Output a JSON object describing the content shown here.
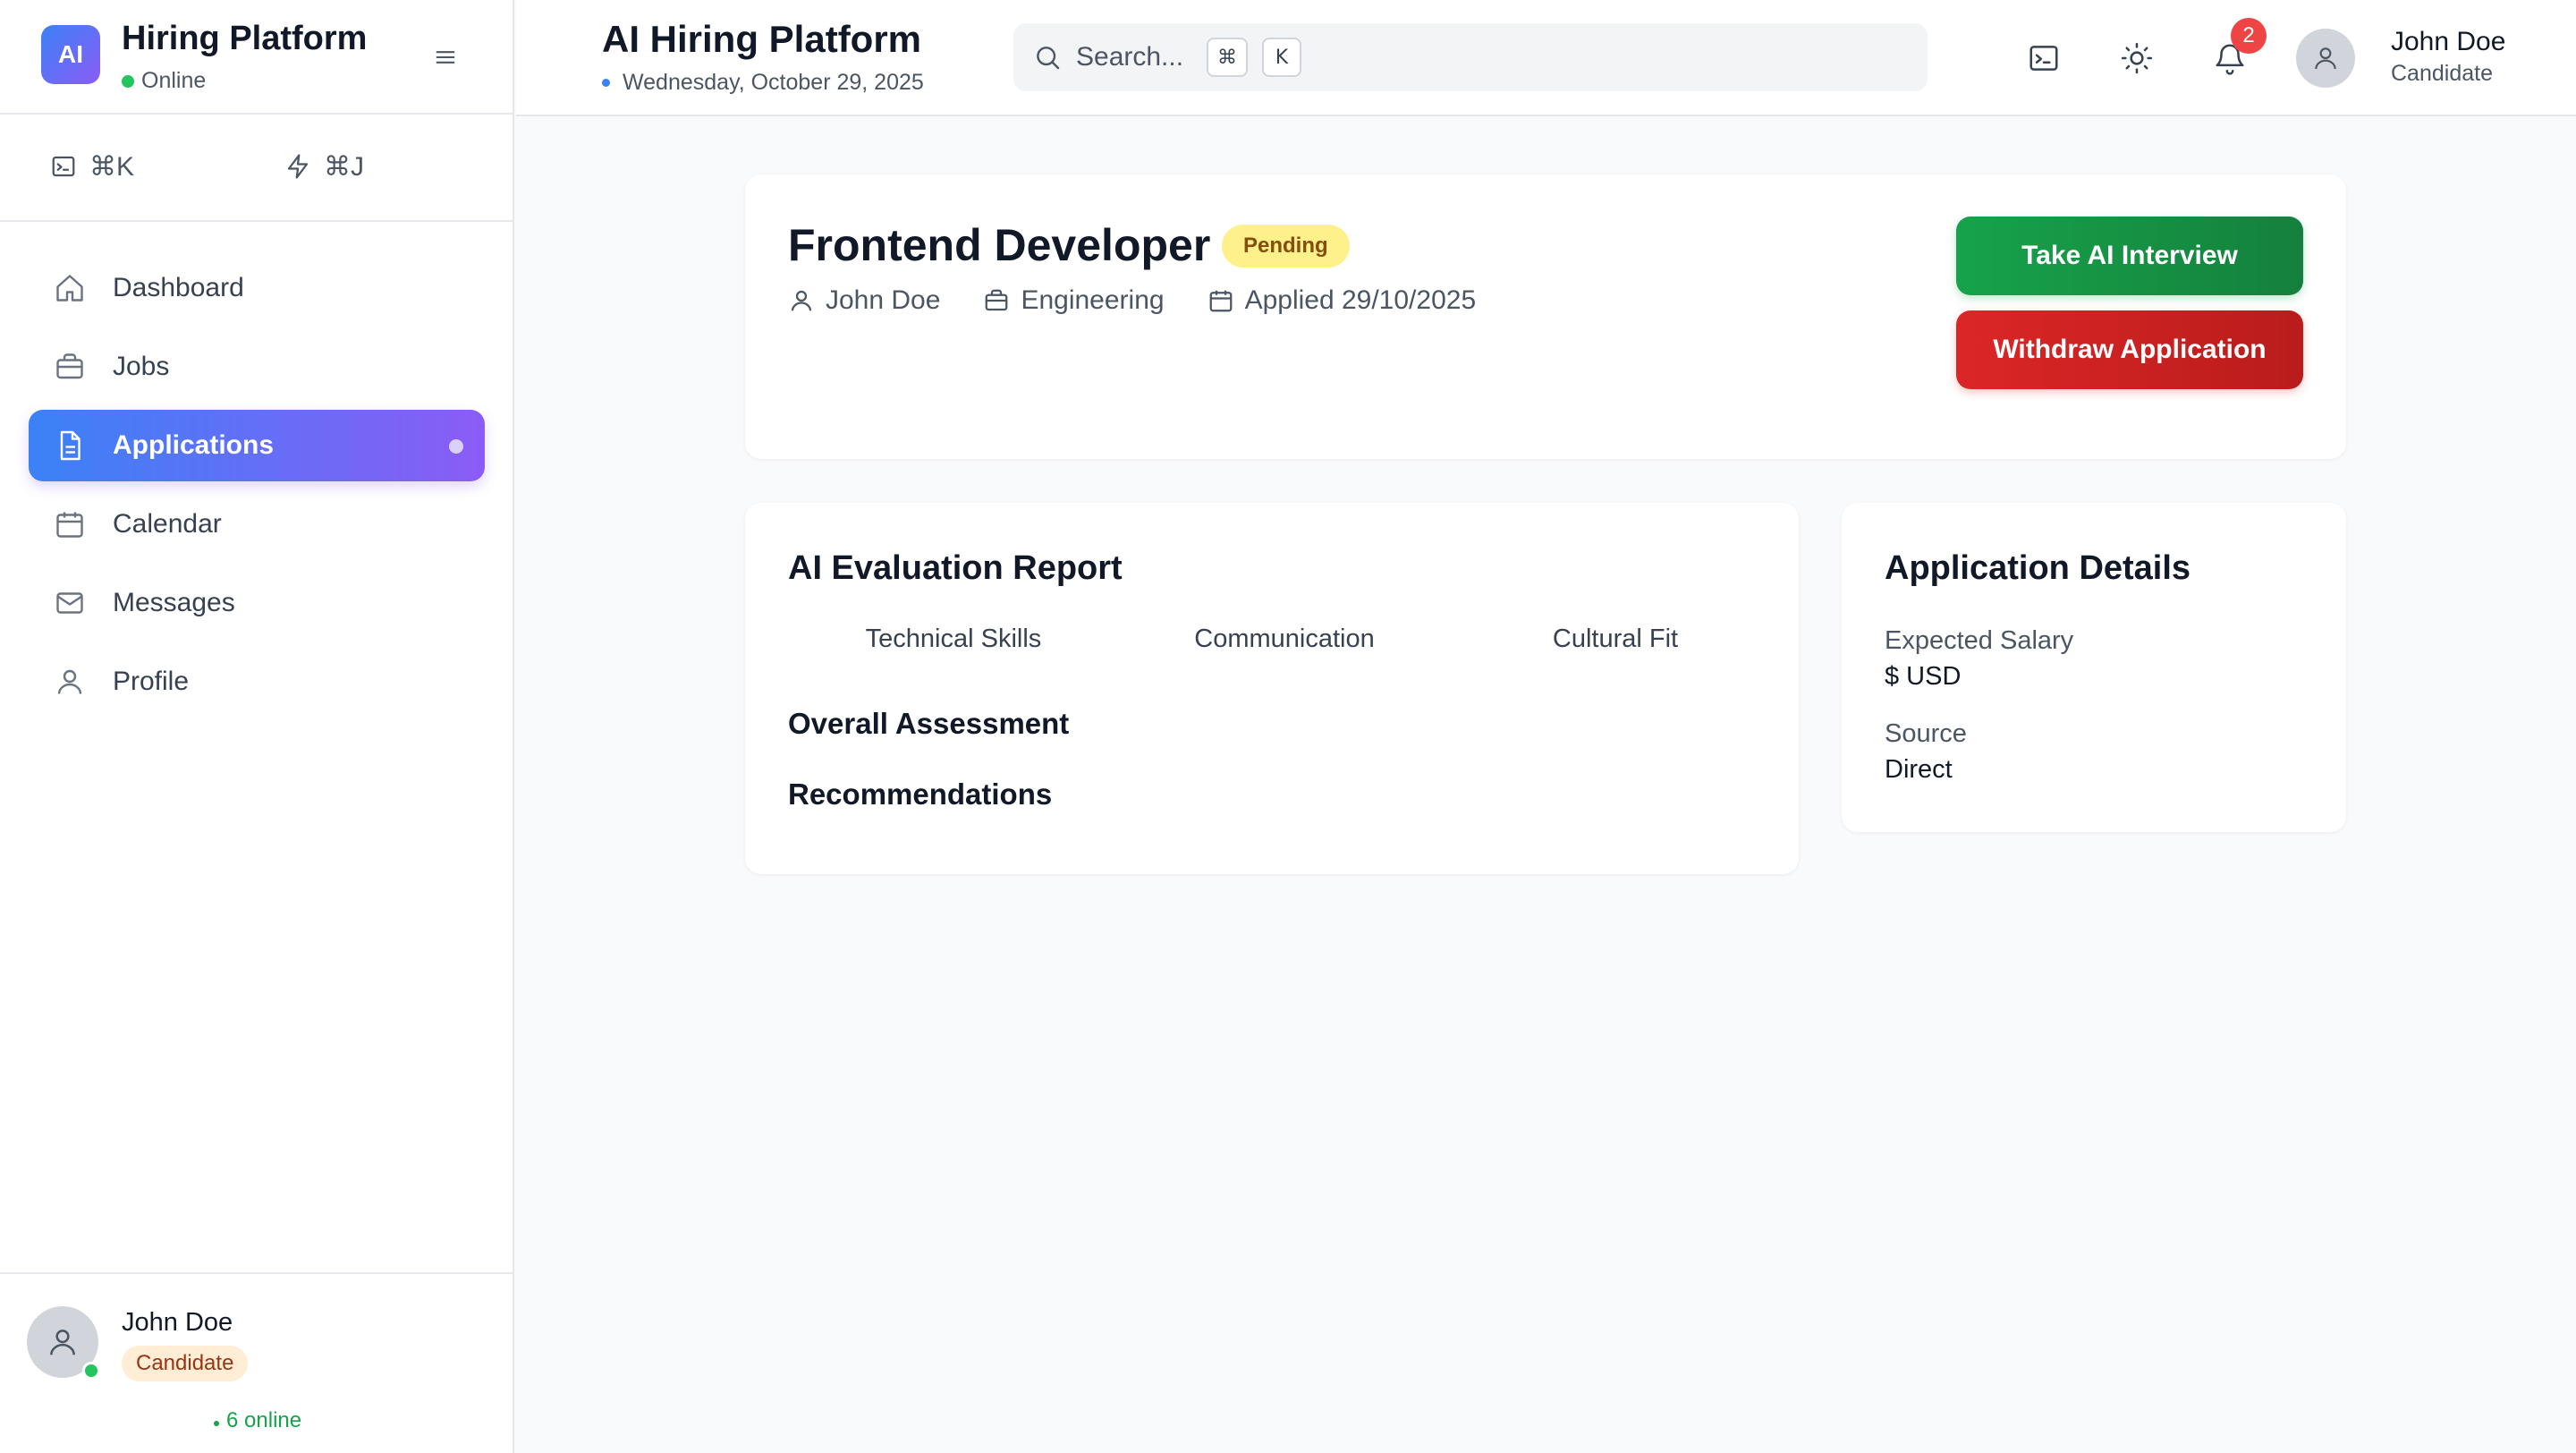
{
  "sidebar": {
    "logo_text": "AI",
    "title": "Hiring Platform",
    "status": "Online",
    "shortcuts": [
      {
        "icon": "terminal-icon",
        "label": "⌘K"
      },
      {
        "icon": "bolt-icon",
        "label": "⌘J"
      }
    ],
    "nav": [
      {
        "icon": "home-icon",
        "label": "Dashboard",
        "active": false
      },
      {
        "icon": "briefcase-icon",
        "label": "Jobs",
        "active": false
      },
      {
        "icon": "document-icon",
        "label": "Applications",
        "active": true
      },
      {
        "icon": "calendar-icon",
        "label": "Calendar",
        "active": false
      },
      {
        "icon": "mail-icon",
        "label": "Messages",
        "active": false
      },
      {
        "icon": "user-icon",
        "label": "Profile",
        "active": false
      }
    ],
    "user": {
      "name": "John Doe",
      "role": "Candidate"
    },
    "online_count": "6 online"
  },
  "topbar": {
    "title": "AI Hiring Platform",
    "date": "Wednesday, October 29, 2025",
    "search": {
      "placeholder": "Search...",
      "kbd1": "⌘",
      "kbd2": "K"
    },
    "notifications_count": "2",
    "user": {
      "name": "John Doe",
      "role": "Candidate"
    }
  },
  "application": {
    "job_title": "Frontend Developer",
    "status": "Pending",
    "candidate": "John Doe",
    "department": "Engineering",
    "applied": "Applied 29/10/2025",
    "actions": {
      "interview": "Take AI Interview",
      "withdraw": "Withdraw Application"
    }
  },
  "evaluation": {
    "title": "AI Evaluation Report",
    "categories": [
      "Technical Skills",
      "Communication",
      "Cultural Fit"
    ],
    "overall_title": "Overall Assessment",
    "recommendations_title": "Recommendations"
  },
  "details": {
    "title": "Application Details",
    "salary_label": "Expected Salary",
    "salary_value": "$ USD",
    "source_label": "Source",
    "source_value": "Direct"
  },
  "colors": {
    "accent_start": "#3b82f6",
    "accent_end": "#8b5cf6",
    "success": "#16a34a",
    "danger": "#dc2626",
    "pending_bg": "#fef08a",
    "badge": "#ef4444"
  }
}
